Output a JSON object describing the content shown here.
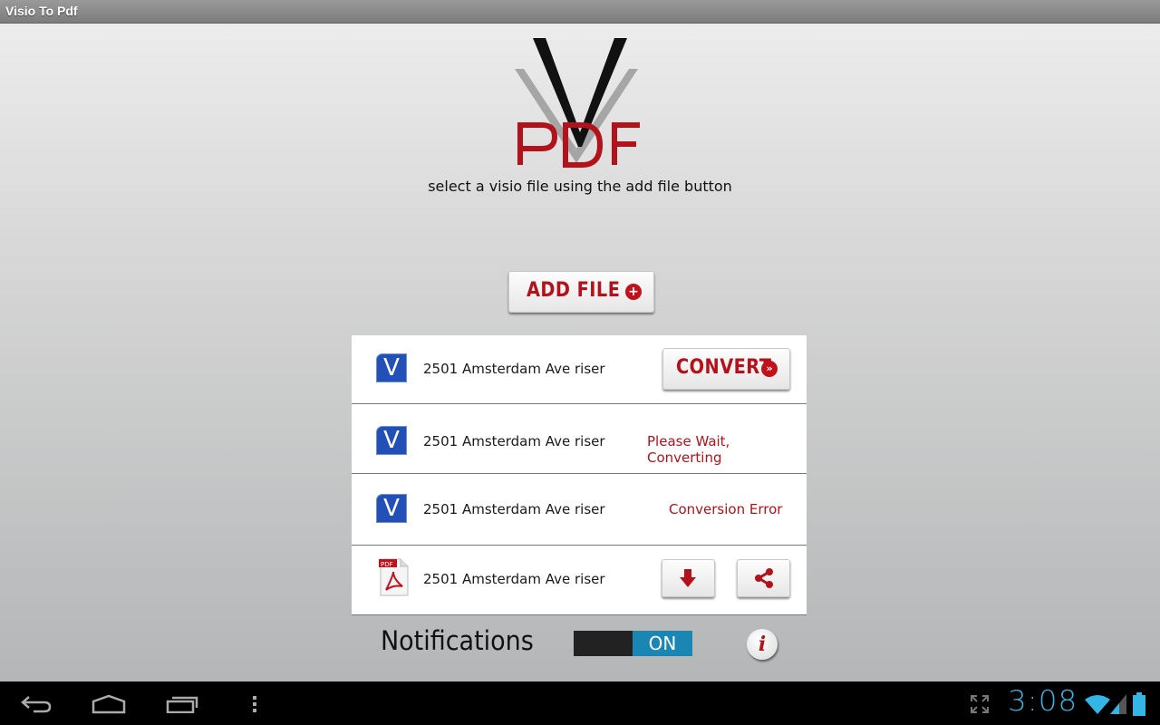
{
  "window": {
    "title": "Visio To Pdf"
  },
  "logo": {
    "letter": "V",
    "text": "PDF"
  },
  "hint": "select a visio file using the add file button",
  "add_file": {
    "label": "ADD FILE",
    "icon": "plus-circle-icon"
  },
  "files": [
    {
      "name": "2501 Amsterdam Ave riser",
      "type_icon": "visio-icon",
      "icon_letter": "V",
      "action": "convert",
      "action_label": "CONVERT"
    },
    {
      "name": "2501 Amsterdam Ave riser",
      "type_icon": "visio-icon",
      "icon_letter": "V",
      "action": "status",
      "status": "Please Wait, Converting"
    },
    {
      "name": "2501 Amsterdam Ave riser",
      "type_icon": "visio-icon",
      "icon_letter": "V",
      "action": "status",
      "status": "Conversion Error"
    },
    {
      "name": "2501 Amsterdam Ave riser",
      "type_icon": "pdf-icon",
      "icon_letter": "PDF",
      "action": "download-share"
    }
  ],
  "notifications": {
    "label": "Notifications",
    "toggle_state": "ON"
  },
  "info_button": {
    "glyph": "i"
  },
  "status_bar": {
    "time": "3:08"
  },
  "colors": {
    "accent_red": "#b3121b",
    "toggle_blue": "#1a86b4",
    "visio_blue": "#2350b7",
    "clock_blue": "#33b5e5"
  }
}
